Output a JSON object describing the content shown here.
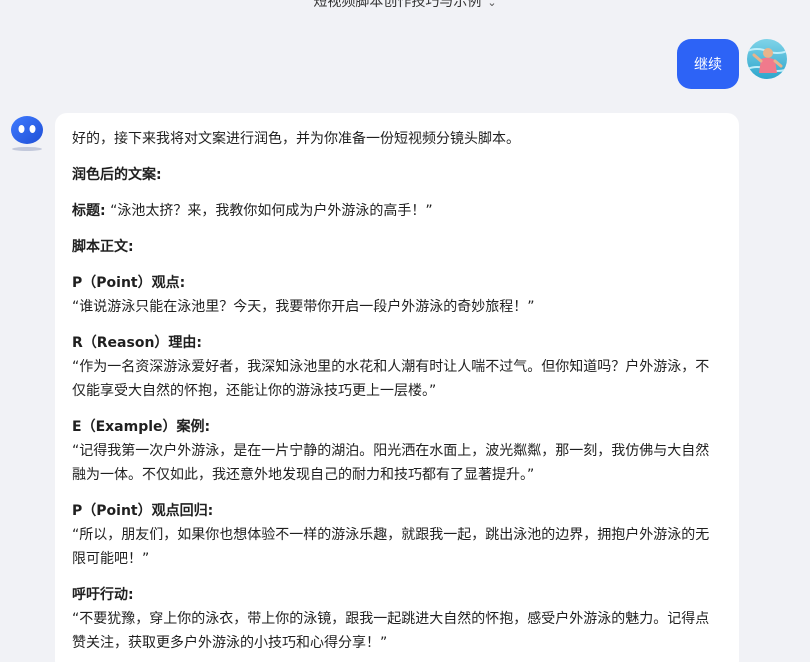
{
  "header": {
    "title": "短视频脚本创作技巧与示例"
  },
  "user_message": {
    "text": "继续"
  },
  "bot_message": {
    "intro": "好的，接下来我将对文案进行润色，并为你准备一份短视频分镜头脚本。",
    "polished_heading": "润色后的文案:",
    "title_label": "标题:",
    "title_text": "“泳池太挤？来，我教你如何成为户外游泳的高手！”",
    "script_heading": "脚本正文:",
    "sections": [
      {
        "heading": "P（Point）观点:",
        "body": "“谁说游泳只能在泳池里？今天，我要带你开启一段户外游泳的奇妙旅程！”"
      },
      {
        "heading": "R（Reason）理由:",
        "body": "“作为一名资深游泳爱好者，我深知泳池里的水花和人潮有时让人喘不过气。但你知道吗？户外游泳，不仅能享受大自然的怀抱，还能让你的游泳技巧更上一层楼。”"
      },
      {
        "heading": "E（Example）案例:",
        "body": "“记得我第一次户外游泳，是在一片宁静的湖泊。阳光洒在水面上，波光粼粼，那一刻，我仿佛与大自然融为一体。不仅如此，我还意外地发现自己的耐力和技巧都有了显著提升。”"
      },
      {
        "heading": "P（Point）观点回归:",
        "body": "“所以，朋友们，如果你也想体验不一样的游泳乐趣，就跟我一起，跳出泳池的边界，拥抱户外游泳的无限可能吧！”"
      },
      {
        "heading": "呼吁行动:",
        "body": "“不要犹豫，穿上你的泳衣，带上你的泳镜，跟我一起跳进大自然的怀抱，感受户外游泳的魅力。记得点赞关注，获取更多户外游泳的小技巧和心得分享！”"
      }
    ]
  },
  "icons": {
    "header_dropdown": "chevron-down-icon",
    "bot_avatar": "robot-avatar-icon",
    "user_avatar": "user-avatar"
  },
  "colors": {
    "accent": "#2d63f6",
    "background": "#f1f2f6",
    "bubble": "#ffffff"
  }
}
